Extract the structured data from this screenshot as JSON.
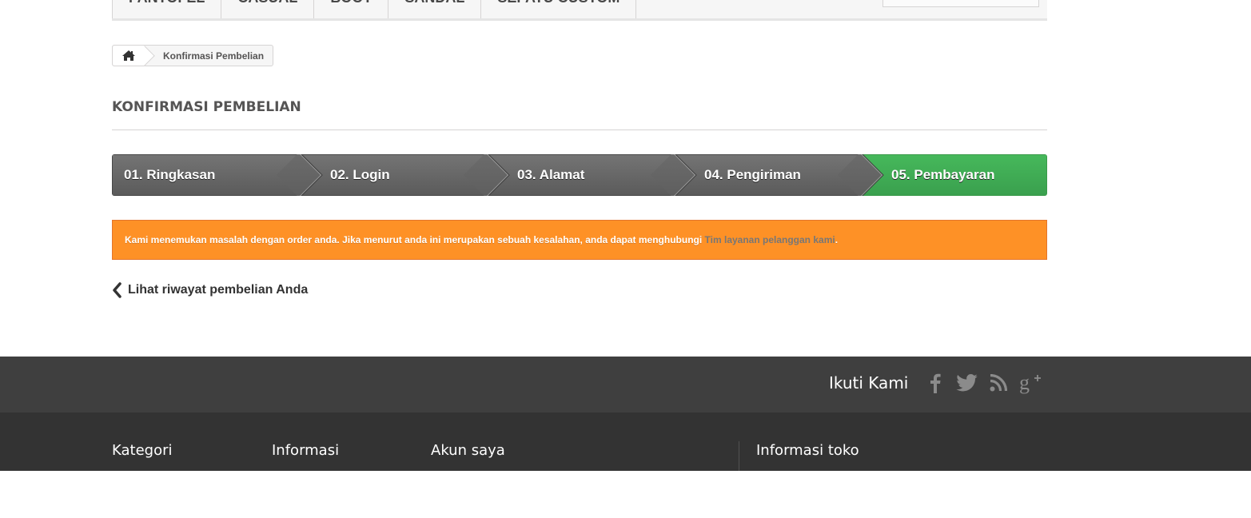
{
  "nav": {
    "items": [
      "Pantofel",
      "Casual",
      "Boot",
      "Sandal",
      "Sepatu Custom"
    ]
  },
  "breadcrumb": {
    "home_icon": "home-icon",
    "current": "Konfirmasi Pembelian"
  },
  "page": {
    "heading": "KONFIRMASI PEMBELIAN"
  },
  "steps": [
    {
      "label": "01. Ringkasan",
      "state": "done"
    },
    {
      "label": "02. Login",
      "state": "done"
    },
    {
      "label": "03. Alamat",
      "state": "done"
    },
    {
      "label": "04. Pengiriman",
      "state": "done"
    },
    {
      "label": "05. Pembayaran",
      "state": "current"
    }
  ],
  "alert": {
    "text": "Kami menemukan masalah dengan order anda. Jika menurut anda ini merupakan sebuah kesalahan, anda dapat menghubungi ",
    "link_text": "Tim layanan pelanggan kami",
    "suffix": ".",
    "color": "#fe9126"
  },
  "back_link": {
    "icon": "chevron-left-icon",
    "label": "Lihat riwayat pembelian Anda"
  },
  "footer": {
    "follow_label": "Ikuti Kami",
    "social_icons": [
      "facebook-icon",
      "twitter-icon",
      "rss-icon",
      "google-plus-icon"
    ],
    "columns": [
      "Kategori",
      "Informasi",
      "Akun saya",
      "Informasi toko"
    ]
  },
  "colors": {
    "step_active": "#46b85b",
    "step_inactive": "#666666",
    "footer_top": "#3f3f3f",
    "footer_bottom": "#333333"
  }
}
